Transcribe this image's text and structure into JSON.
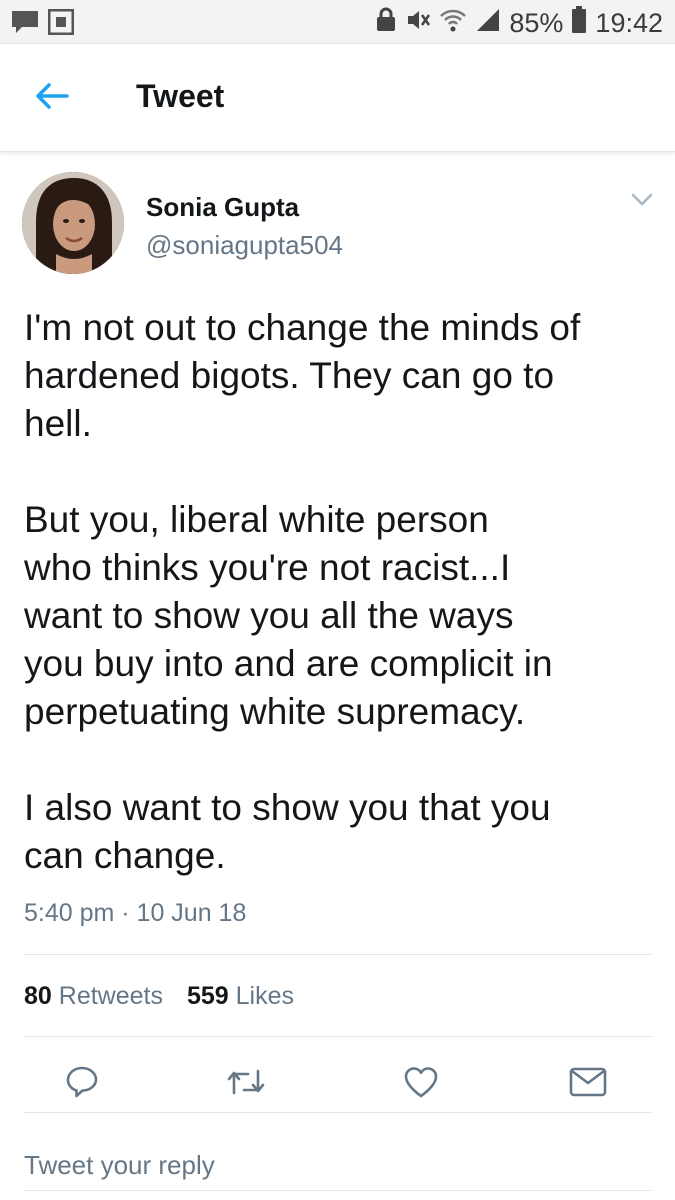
{
  "status_bar": {
    "battery": "85%",
    "time": "19:42",
    "icons": [
      "chat-icon",
      "gallery-icon",
      "lock-icon",
      "mute-icon",
      "wifi-icon",
      "signal-icon",
      "battery-icon"
    ]
  },
  "header": {
    "back_icon": "back-arrow-icon",
    "title": "Tweet"
  },
  "tweet": {
    "author_name": "Sonia Gupta",
    "author_handle": "@soniagupta504",
    "paragraphs": [
      [
        "I'm not out to change the minds of",
        "hardened bigots. They can go to",
        "hell."
      ],
      [
        "But you, liberal white person",
        "who thinks you're not racist...I",
        "want to show you all the ways",
        "you buy into and are complicit in",
        "perpetuating white supremacy."
      ],
      [
        "I also want to show you that you",
        "can change."
      ]
    ],
    "timestamp": "5:40 pm · 10 Jun 18"
  },
  "stats": {
    "retweets_count": "80",
    "retweets_label": "Retweets",
    "likes_count": "559",
    "likes_label": "Likes"
  },
  "actions": [
    "reply-icon",
    "retweet-icon",
    "like-icon",
    "message-icon"
  ],
  "reply": {
    "placeholder": "Tweet your reply"
  },
  "colors": {
    "accent": "#1da1f2",
    "secondary_text": "#657786",
    "primary_text": "#14171a",
    "divider": "#e1e8ed"
  }
}
